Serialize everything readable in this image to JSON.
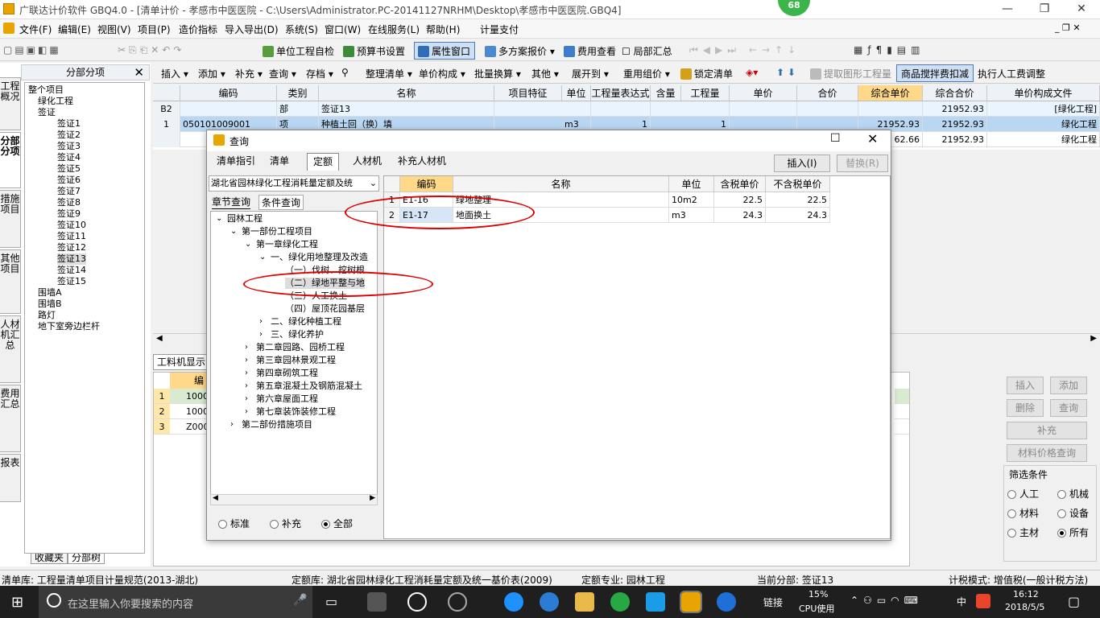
{
  "app": {
    "title": "广联达计价软件 GBQ4.0 - [清单计价 - 孝感市中医医院 - C:\\Users\\Administrator.PC-20141127NRHM\\Desktop\\孝感市中医医院.GBQ4]",
    "badge": "68"
  },
  "menu": [
    "文件(F)",
    "编辑(E)",
    "视图(V)",
    "项目(P)",
    "造价指标",
    "导入导出(D)",
    "系统(S)",
    "窗口(W)",
    "在线服务(L)",
    "帮助(H)",
    "计量支付"
  ],
  "toolbar1": {
    "self_check": "单位工程自检",
    "budget_settings": "预算书设置",
    "property_window": "属性窗口",
    "multi_plan": "多方案报价",
    "fee_view": "费用查看",
    "partial_summary": "局部汇总"
  },
  "toolbar2": {
    "insert": "插入",
    "add": "添加",
    "supplement": "补充",
    "query": "查询",
    "save": "存档",
    "arrange": "整理清单",
    "unit_comp": "单价构成",
    "batch": "批量换算",
    "other": "其他",
    "expand": "展开到",
    "reuse": "重用组价",
    "lock": "锁定清单",
    "extract": "提取图形工程量",
    "mix_deduct": "商品搅拌费扣减",
    "exec_labor": "执行人工费调整"
  },
  "left": {
    "header": "分部分项",
    "tabs": [
      "工程概况",
      "分部分项",
      "措施项目",
      "其他项目",
      "人材机汇总",
      "费用汇总",
      "报表"
    ],
    "tree": [
      {
        "label": "整个项目",
        "indent": 0
      },
      {
        "label": "绿化工程",
        "indent": 1
      },
      {
        "label": "签证",
        "indent": 1,
        "exp": "-"
      },
      {
        "label": "签证1",
        "indent": 3
      },
      {
        "label": "签证2",
        "indent": 3
      },
      {
        "label": "签证3",
        "indent": 3
      },
      {
        "label": "签证4",
        "indent": 3
      },
      {
        "label": "签证5",
        "indent": 3
      },
      {
        "label": "签证6",
        "indent": 3
      },
      {
        "label": "签证7",
        "indent": 3
      },
      {
        "label": "签证8",
        "indent": 3
      },
      {
        "label": "签证9",
        "indent": 3
      },
      {
        "label": "签证10",
        "indent": 3
      },
      {
        "label": "签证11",
        "indent": 3
      },
      {
        "label": "签证12",
        "indent": 3
      },
      {
        "label": "签证13",
        "indent": 3,
        "sel": true
      },
      {
        "label": "签证14",
        "indent": 3
      },
      {
        "label": "签证15",
        "indent": 3
      },
      {
        "label": "围墙A",
        "indent": 1
      },
      {
        "label": "围墙B",
        "indent": 1
      },
      {
        "label": "路灯",
        "indent": 1
      },
      {
        "label": "地下室旁边栏杆",
        "indent": 1
      }
    ],
    "bottom_tabs": [
      "收藏夹",
      "分部树"
    ]
  },
  "grid": {
    "headers": [
      "编码",
      "类别",
      "名称",
      "项目特征",
      "单位",
      "工程量表达式",
      "含量",
      "工程量",
      "单价",
      "合价",
      "综合单价",
      "综合合价",
      "单价构成文件"
    ],
    "rows": [
      {
        "no": "B2",
        "code": "",
        "type": "部",
        "name": "签证13",
        "unit": "",
        "expr": "",
        "qty": "",
        "price": "",
        "total": "",
        "cp": "",
        "ct": "21952.93",
        "file": "[绿化工程]"
      },
      {
        "no": "1",
        "code": "050101009001",
        "type": "项",
        "name": "种植土回（换）填",
        "unit": "m3",
        "expr": "1",
        "qty": "1",
        "price": "",
        "total": "",
        "cp": "21952.93",
        "ct": "21952.93",
        "file": "绿化工程"
      },
      {
        "no": "",
        "code": "",
        "type": "",
        "name": "",
        "unit": "",
        "expr": "",
        "qty": "",
        "price": "",
        "total": "",
        "cp": "62.66",
        "ct": "21952.93",
        "file": "绿化工程"
      }
    ]
  },
  "lower": {
    "tab": "工料机显示",
    "col": "编码",
    "rows": [
      "10000",
      "10000",
      "Z000"
    ]
  },
  "right_buttons": {
    "insert": "插入",
    "add": "添加",
    "delete": "删除",
    "query": "查询",
    "supplement": "补充",
    "material_query": "材料价格查询",
    "filter_title": "筛选条件",
    "filters": [
      "人工",
      "机械",
      "材料",
      "设备",
      "主材",
      "所有"
    ]
  },
  "dialog": {
    "title": "查询",
    "tabs": [
      "清单指引",
      "清单",
      "定额",
      "人材机",
      "补充人材机"
    ],
    "insert_btn": "插入(I)",
    "replace_btn": "替换(R)",
    "library": "湖北省园林绿化工程消耗量定额及统",
    "subtabs": [
      "章节查询",
      "条件查询"
    ],
    "tree": [
      {
        "label": "园林工程",
        "level": 0,
        "exp": "v"
      },
      {
        "label": "第一部份工程项目",
        "level": 1,
        "exp": "v"
      },
      {
        "label": "第一章绿化工程",
        "level": 2,
        "exp": "v"
      },
      {
        "label": "一、绿化用地整理及改造",
        "level": 3,
        "exp": "v"
      },
      {
        "label": "（一）伐树、挖树根",
        "level": 4
      },
      {
        "label": "（二）绿地平整与地",
        "level": 4,
        "sel": true
      },
      {
        "label": "（三）人工换土",
        "level": 4
      },
      {
        "label": "（四）屋顶花园基层",
        "level": 4
      },
      {
        "label": "二、绿化种植工程",
        "level": 3,
        "exp": ">"
      },
      {
        "label": "三、绿化养护",
        "level": 3,
        "exp": ">"
      },
      {
        "label": "第二章园路、园桥工程",
        "level": 2,
        "exp": ">"
      },
      {
        "label": "第三章园林景观工程",
        "level": 2,
        "exp": ">"
      },
      {
        "label": "第四章砌筑工程",
        "level": 2,
        "exp": ">"
      },
      {
        "label": "第五章混凝土及钢筋混凝土",
        "level": 2,
        "exp": ">"
      },
      {
        "label": "第六章屋面工程",
        "level": 2,
        "exp": ">"
      },
      {
        "label": "第七章装饰装修工程",
        "level": 2,
        "exp": ">"
      },
      {
        "label": "第二部份措施项目",
        "level": 1,
        "exp": ">"
      }
    ],
    "radios": [
      "标准",
      "补充",
      "全部"
    ],
    "table": {
      "headers": [
        "编码",
        "名称",
        "单位",
        "含税单价",
        "不含税单价"
      ],
      "rows": [
        {
          "no": "1",
          "code": "E1-16",
          "name": "绿地整理",
          "unit": "10m2",
          "tax": "22.5",
          "notax": "22.5"
        },
        {
          "no": "2",
          "code": "E1-17",
          "name": "地面换土",
          "unit": "m3",
          "tax": "24.3",
          "notax": "24.3"
        }
      ]
    }
  },
  "status": {
    "list_lib": "清单库: 工程量清单项目计量规范(2013-湖北)",
    "quota_lib": "定额库: 湖北省园林绿化工程消耗量定额及统一基价表(2009)",
    "quota_major": "定额专业: 园林工程",
    "current": "当前分部: 签证13",
    "tax_mode": "计税模式: 增值税(一般计税方法)"
  },
  "taskbar": {
    "search": "在这里输入你要搜索的内容",
    "link": "链接",
    "cpu": "15%",
    "cpu_label": "CPU使用",
    "time": "16:12",
    "date": "2018/5/5",
    "ime": "中"
  }
}
